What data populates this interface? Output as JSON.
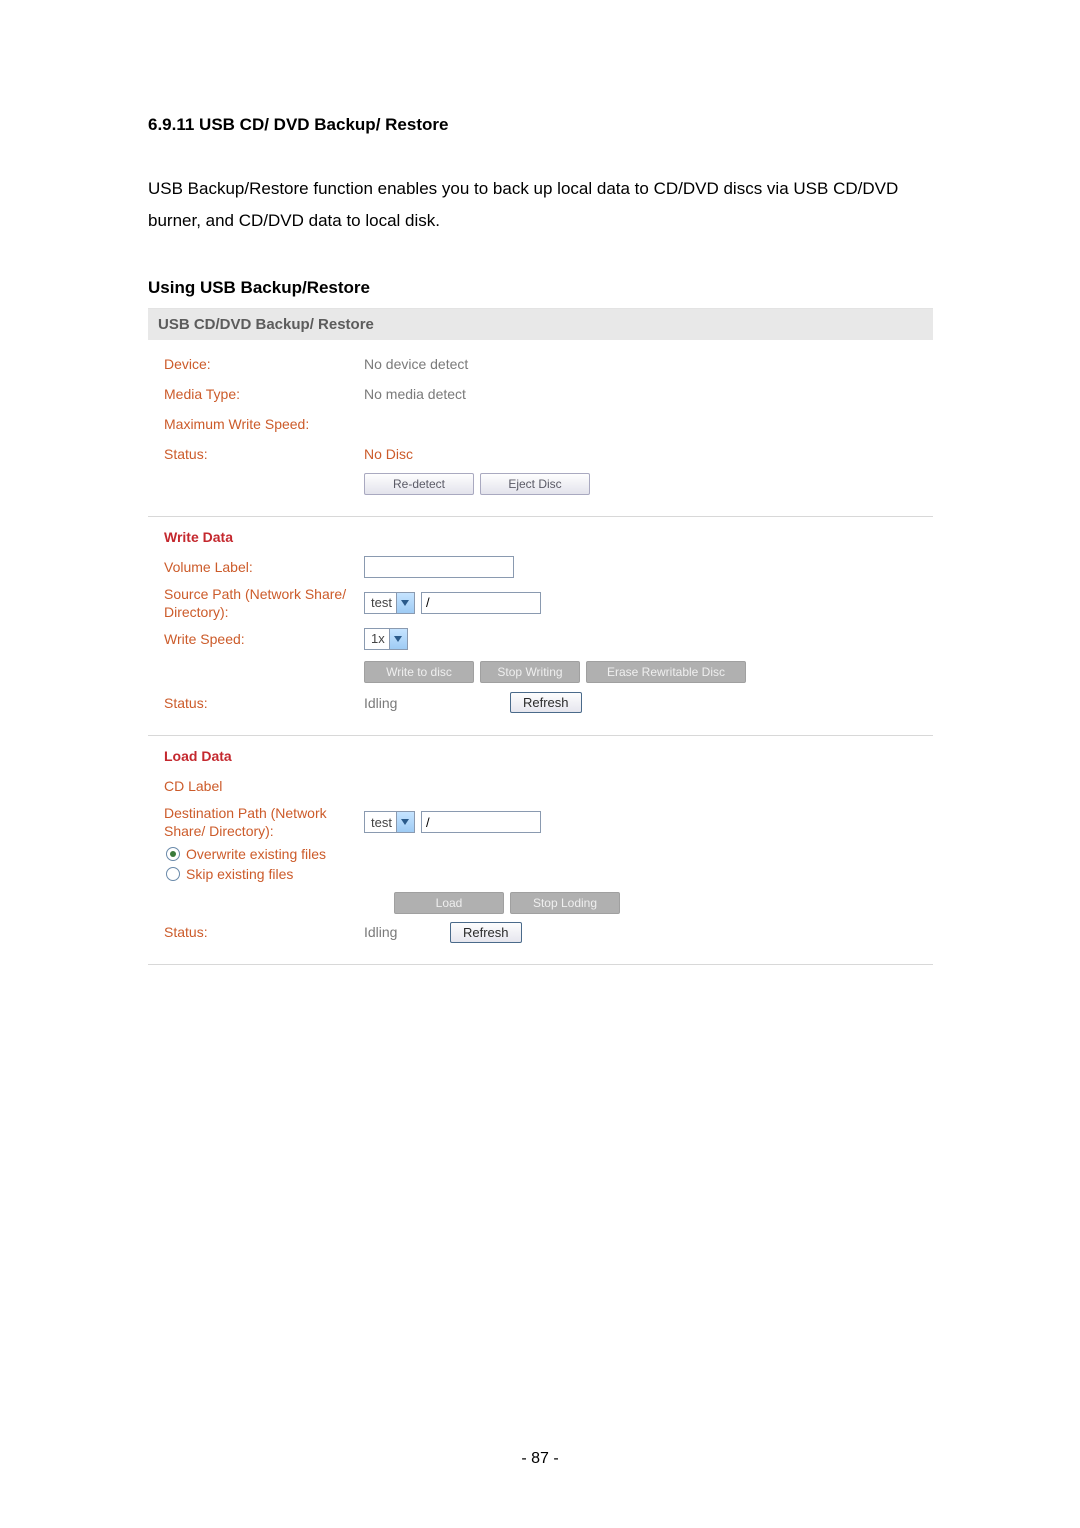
{
  "doc": {
    "heading": "6.9.11  USB CD/ DVD Backup/ Restore",
    "body": "USB Backup/Restore function enables you to back up local data to CD/DVD discs via USB CD/DVD burner, and CD/DVD data to local disk.",
    "subheading": "Using USB Backup/Restore",
    "pagenum": "- 87 -"
  },
  "panel": {
    "title": "USB CD/DVD Backup/ Restore"
  },
  "info": {
    "device_label": "Device:",
    "device_value": "No device detect",
    "media_label": "Media Type:",
    "media_value": "No media detect",
    "maxspeed_label": "Maximum Write Speed:",
    "maxspeed_value": "",
    "status_label": "Status:",
    "status_value": "No Disc",
    "redetect": "Re-detect",
    "eject": "Eject Disc"
  },
  "write": {
    "title": "Write Data",
    "volume_label": "Volume Label:",
    "volume_value": "",
    "source_label": "Source Path (Network Share/ Directory):",
    "source_select": "test",
    "source_path": "/",
    "speed_label": "Write Speed:",
    "speed_select": "1x",
    "btn_write": "Write to disc",
    "btn_stop": "Stop Writing",
    "btn_erase": "Erase Rewritable Disc",
    "status_label": "Status:",
    "status_value": "Idling",
    "refresh": "Refresh"
  },
  "load": {
    "title": "Load Data",
    "cdlabel": "CD Label",
    "dest_label": "Destination Path (Network Share/ Directory):",
    "dest_select": "test",
    "dest_path": "/",
    "opt_overwrite": "Overwrite existing files",
    "opt_skip": "Skip existing files",
    "btn_load": "Load",
    "btn_stop": "Stop Loding",
    "status_label": "Status:",
    "status_value": "Idling",
    "refresh": "Refresh"
  }
}
